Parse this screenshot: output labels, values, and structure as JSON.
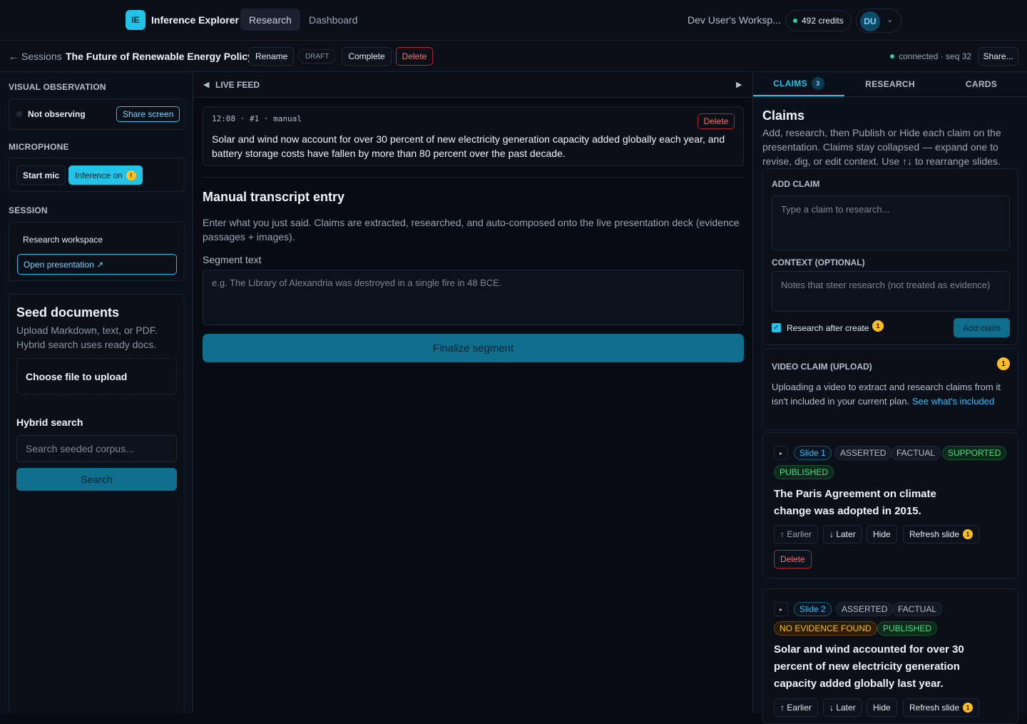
{
  "topbar": {
    "logo": "IE",
    "app_name": "Inference Explorer",
    "tabs": [
      {
        "label": "Research"
      },
      {
        "label": "Dashboard"
      }
    ],
    "workspace": "Dev User's Worksp...",
    "credits": "492 credits",
    "avatar": "DU"
  },
  "subbar": {
    "back": "← Sessions",
    "title": "The Future of Renewable Energy Policy",
    "rename": "Rename",
    "status": "DRAFT",
    "complete": "Complete",
    "delete": "Delete",
    "connection": "connected · seq 32",
    "share": "Share..."
  },
  "left": {
    "visual_title": "VISUAL OBSERVATION",
    "not_observing": "Not observing",
    "share_screen": "Share screen",
    "mic_title": "MICROPHONE",
    "start_mic": "Start mic",
    "inference_on": "Inference on",
    "session_title": "SESSION",
    "research_workspace": "Research workspace",
    "open_presentation": "Open presentation ↗",
    "seed_title": "Seed documents",
    "seed_desc": "Upload Markdown, text, or PDF. Hybrid search uses ready docs.",
    "choose_file": "Choose file to upload",
    "hybrid_title": "Hybrid search",
    "search_placeholder": "Search seeded corpus...",
    "search_button": "Search"
  },
  "center": {
    "feed_title": "LIVE FEED",
    "entry_meta": "12:08 · #1 · manual",
    "entry_delete": "Delete",
    "entry_text": "Solar and wind now account for over 30 percent of new electricity generation capacity added globally each year, and battery storage costs have fallen by more than 80 percent over the past decade.",
    "manual_title": "Manual transcript entry",
    "manual_desc": "Enter what you just said. Claims are extracted, researched, and auto-composed onto the live presentation deck (evidence passages + images).",
    "segment_label": "Segment text",
    "segment_placeholder": "e.g. The Library of Alexandria was destroyed in a single fire in 48 BCE.",
    "finalize": "Finalize segment"
  },
  "right": {
    "tabs": [
      {
        "label": "CLAIMS",
        "count": "3"
      },
      {
        "label": "RESEARCH"
      },
      {
        "label": "CARDS"
      }
    ],
    "claims_title": "Claims",
    "claims_desc": "Add, research, then Publish or Hide each claim on the presentation. Claims stay collapsed — expand one to revise, dig, or edit context. Use ↑↓ to rearrange slides.",
    "add_claim_label": "ADD CLAIM",
    "claim_placeholder": "Type a claim to research...",
    "context_label": "CONTEXT (OPTIONAL)",
    "context_placeholder": "Notes that steer research (not treated as evidence)",
    "research_after": "Research after create",
    "add_claim_button": "Add claim",
    "video_title": "VIDEO CLAIM (UPLOAD)",
    "video_desc": "Uploading a video to extract and research claims from it isn't included in your current plan.",
    "video_link": "See what's included",
    "claims": [
      {
        "slide": "Slide 1",
        "tags": [
          "ASSERTED",
          "FACTUAL",
          "SUPPORTED",
          "PUBLISHED"
        ],
        "text": "The Paris Agreement on climate change was adopted in 2015.",
        "earlier": "↑ Earlier",
        "later": "↓ Later",
        "hide": "Hide",
        "refresh": "Refresh slide",
        "delete": "Delete"
      },
      {
        "slide": "Slide 2",
        "tags": [
          "ASSERTED",
          "FACTUAL",
          "NO EVIDENCE FOUND",
          "PUBLISHED"
        ],
        "text": "Solar and wind accounted for over 30 percent of new electricity generation capacity added globally last year.",
        "earlier": "↑ Earlier",
        "later": "↓ Later",
        "hide": "Hide",
        "refresh": "Refresh slide"
      }
    ]
  },
  "colors": {
    "accent": "#22c3e6",
    "primary_button": "#0e6e8c",
    "danger": "#f87171",
    "success": "#34d399",
    "warning": "#fbbf24"
  }
}
